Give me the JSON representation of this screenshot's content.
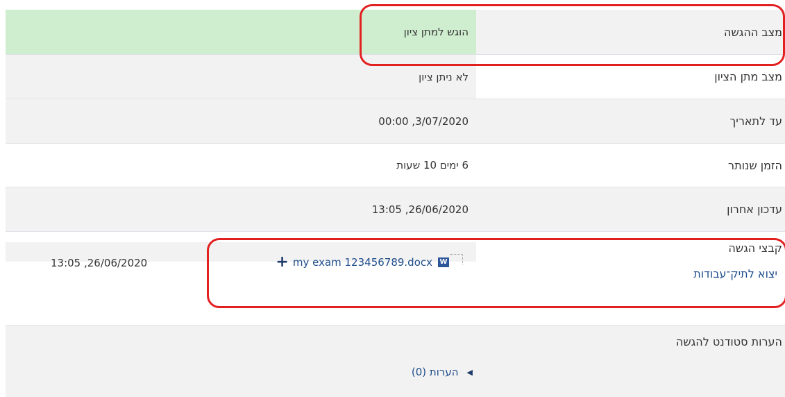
{
  "rows": [
    {
      "label": "מצב ההגשה",
      "value": "הוגש למתן ציון"
    },
    {
      "label": "מצב מתן הציון",
      "value": "לא ניתן ציון"
    },
    {
      "label": "עד לתאריך",
      "value": "3/07/2020, 00:00"
    },
    {
      "label": "הזמן שנותר",
      "value": "6 ימים 10 שעות"
    },
    {
      "label": "עדכון אחרון",
      "value": "26/06/2020, 13:05"
    }
  ],
  "files": {
    "label": "קבצי הגשה",
    "file_name": "my exam 123456789.docx",
    "file_icon": "W",
    "file_date": "13:05 ,26/06/2020",
    "export_link": "יצוא לתיק־עבודות"
  },
  "comments_row": {
    "label": "הערות סטודנט להגשה",
    "link": "הערות (0)"
  },
  "colors": {
    "submitted_green": "#cfeecf",
    "highlight_red": "#e32020",
    "link_blue": "#1f4e8c"
  }
}
